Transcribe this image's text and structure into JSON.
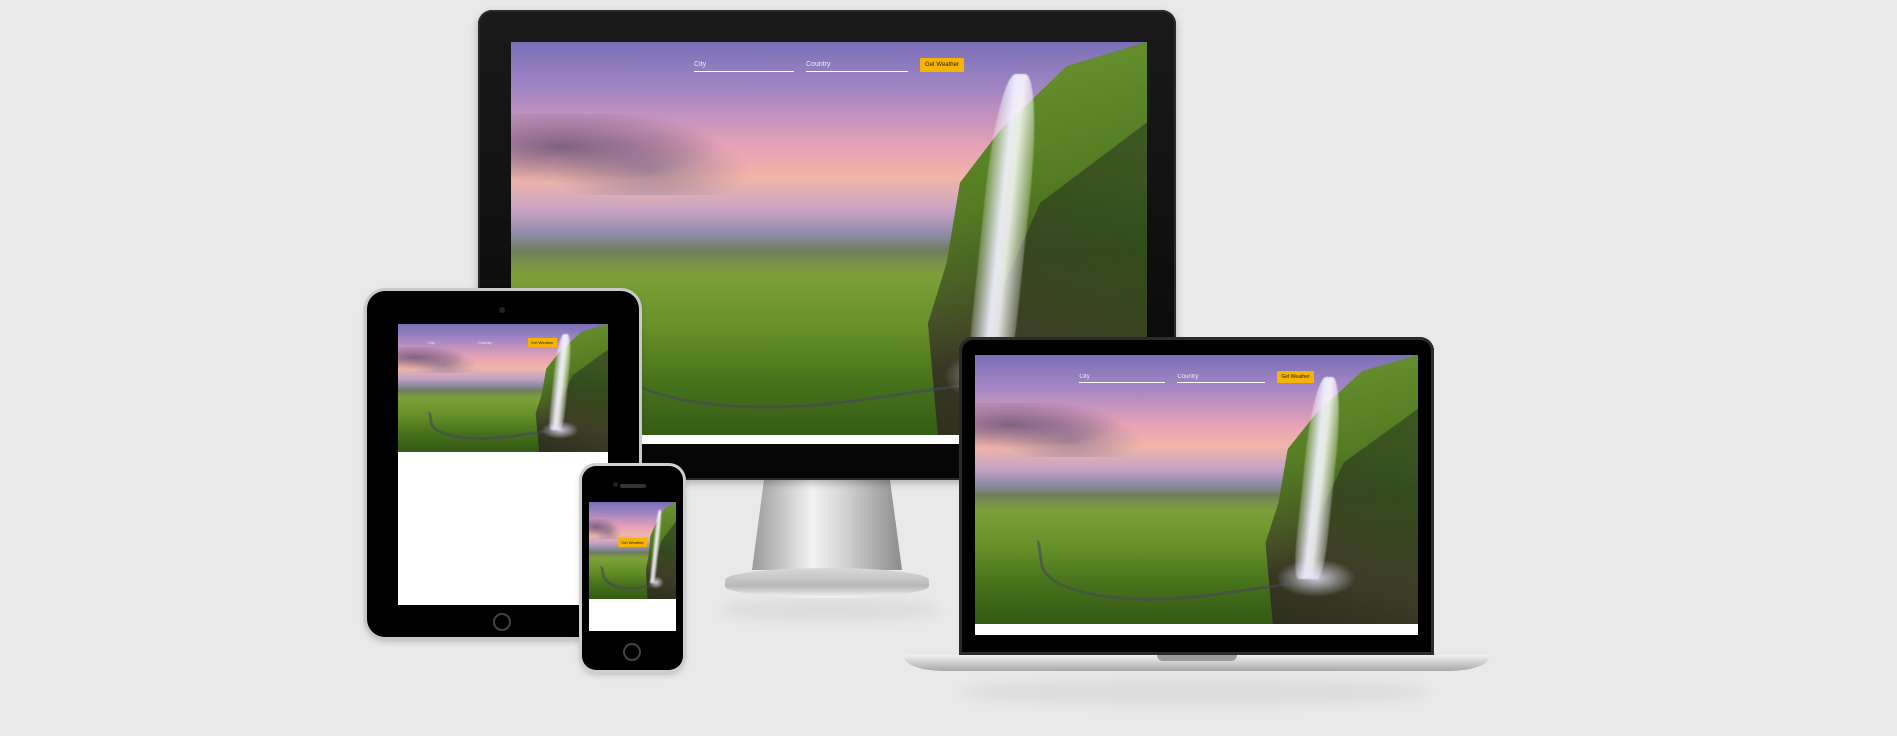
{
  "app": {
    "city_placeholder": "City",
    "country_placeholder": "Country",
    "button_label": "Get Weather"
  },
  "colors": {
    "page_background": "#e9e9e9",
    "button": "#f5b400",
    "device_bezel": "#000000"
  }
}
